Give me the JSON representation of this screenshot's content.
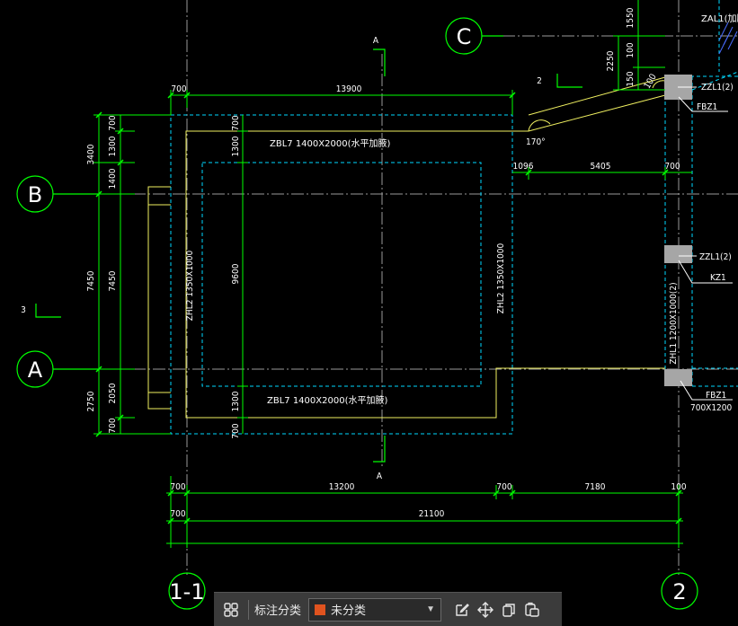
{
  "axes": {
    "C": "C",
    "B": "B",
    "A": "A",
    "axis_1_1": "1-1",
    "axis_2": "2"
  },
  "section_marks": {
    "top": "A",
    "bottom": "A",
    "mark2": "2",
    "mark3": "3"
  },
  "dims": {
    "top_700": "700",
    "top_13900": "13900",
    "row_1096": "1096",
    "row_5405": "5405",
    "row_700b": "700",
    "b1_700": "700",
    "b1_13200": "13200",
    "b1_700b": "700",
    "b1_7180": "7180",
    "b1_100": "100",
    "b2_700": "700",
    "b2_21100": "21100",
    "l_3400": "3400",
    "l_7450": "7450",
    "l_2750": "2750",
    "l_700": "700",
    "l_1300": "1300",
    "l_1400": "1400",
    "l_7450b": "7450",
    "l_2050": "2050",
    "l_700b": "700",
    "in_700": "700",
    "in_1300": "1300",
    "in_9600": "9600",
    "in_1300b": "1300",
    "in_700b": "700",
    "tr_1550": "1550",
    "tr_100": "100",
    "tr_2250": "2250",
    "tr_150": "150",
    "tr_100b": "100"
  },
  "labels": {
    "zbl7_top": "ZBL7 1400X2000(水平加腋)",
    "zbl7_bottom": "ZBL7 1400X2000(水平加腋)",
    "zhl2_left": "ZHL2 1350X1000",
    "zhl2_right": "ZHL2 1350X1000",
    "zhl1": "ZHL1 1200X1000(2)",
    "angle": "170°",
    "zal1": "ZAL1(加腋)",
    "zzl1_top": "ZZL1(2)",
    "fbz1_top": "FBZ1",
    "zzl1_mid": "ZZL1(2)",
    "kz1": "KZ1",
    "fbz1_bottom": "FBZ1",
    "fbz1_size": "700X1200"
  },
  "toolbar": {
    "label": "标注分类",
    "select_value": "未分类"
  }
}
